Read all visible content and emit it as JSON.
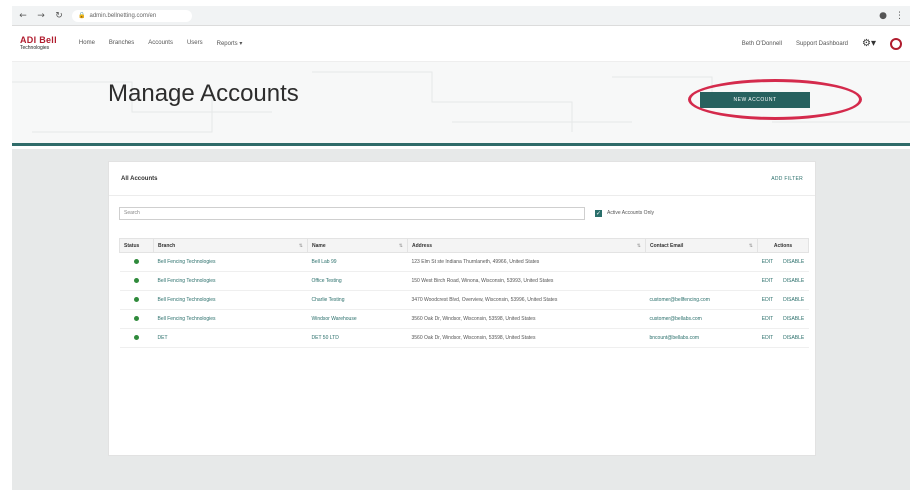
{
  "browser": {
    "url": "admin.bellnetting.com/en",
    "nav": [
      "←",
      "→",
      "↻"
    ]
  },
  "header": {
    "logo_line1": "ADI Bell",
    "logo_line2": "Technologies",
    "nav": [
      "Home",
      "Branches",
      "Accounts",
      "Users",
      "Reports ▾"
    ],
    "user_name": "Beth O'Donnell",
    "support": "Support Dashboard"
  },
  "banner": {
    "title": "Manage Accounts",
    "new_account_label": "NEW ACCOUNT",
    "accent_color": "#27615f",
    "highlight_color": "#d42a4c"
  },
  "card": {
    "title": "All Accounts",
    "add_filter_label": "ADD FILTER",
    "search_placeholder": "Search",
    "active_only_label": "Active Accounts Only",
    "columns": [
      "Status",
      "Branch",
      "Name",
      "Address",
      "Contact Email",
      "Actions"
    ],
    "rows": [
      {
        "branch": "Bell Fencing Technologies",
        "name": "Bell Lab 99",
        "address": "123 Elm St ste Indiana Thurnlaneth, 49966, United States",
        "email": "",
        "edit": "EDIT",
        "disable": "DISABLE"
      },
      {
        "branch": "Bell Fencing Technologies",
        "name": "Office Testing",
        "address": "150 West Birch Road, Winona, Wisconsin, 53993, United States",
        "email": "",
        "edit": "EDIT",
        "disable": "DISABLE"
      },
      {
        "branch": "Bell Fencing Technologies",
        "name": "Charlie Testing",
        "address": "3470 Woodcrest Blvd, Overview, Wisconsin, 53996, United States",
        "email": "customer@bellfencing.com",
        "edit": "EDIT",
        "disable": "DISABLE"
      },
      {
        "branch": "Bell Fencing Technologies",
        "name": "Windsor Warehouse",
        "address": "3560 Oak Dr, Windsor, Wisconsin, 53598, United States",
        "email": "customer@bellabs.com",
        "edit": "EDIT",
        "disable": "DISABLE"
      },
      {
        "branch": "DET",
        "name": "DET 50 LTD",
        "address": "3560 Oak Dr, Windsor, Wisconsin, 53598, United States",
        "email": "bncount@bellabs.com",
        "edit": "EDIT",
        "disable": "DISABLE"
      }
    ]
  }
}
